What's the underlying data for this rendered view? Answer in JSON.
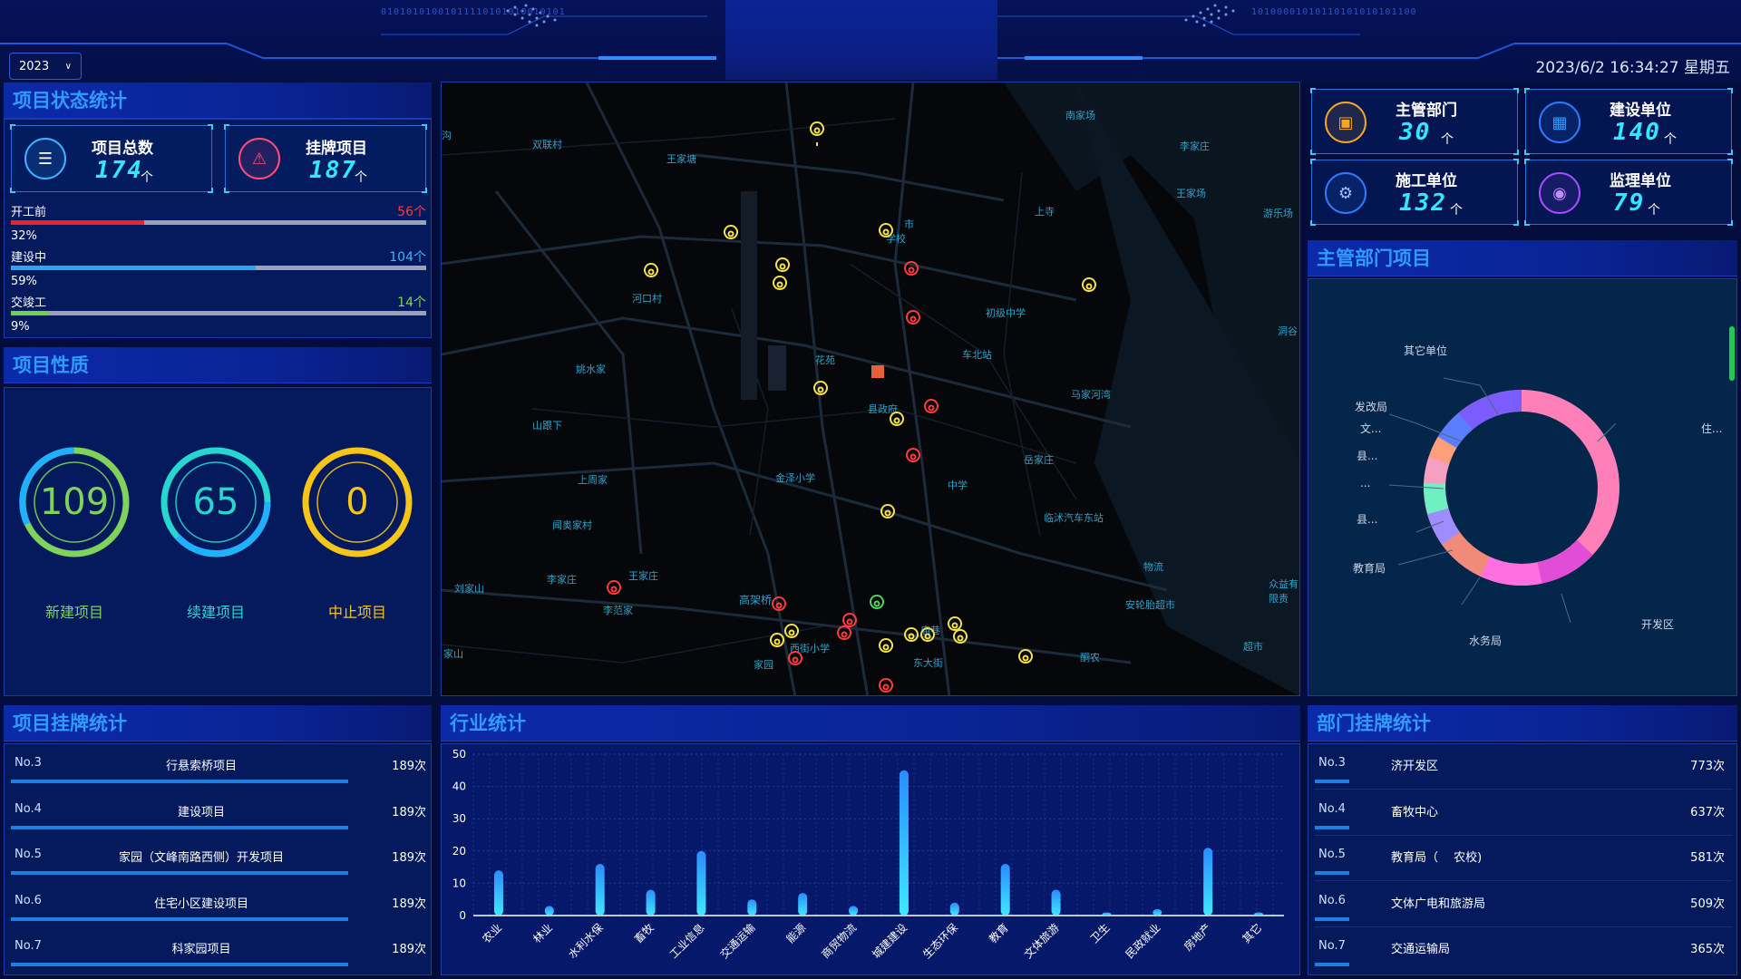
{
  "header": {
    "year": "2023",
    "datetime": "2023/6/2 16:34:27 星期五",
    "binary_left": "01010101001011110101010010101",
    "binary_right": "10100001010110101010101100"
  },
  "status_panel": {
    "title": "项目状态统计",
    "total_label": "项目总数",
    "total_value": "174",
    "total_unit": "个",
    "listed_label": "挂牌项目",
    "listed_value": "187",
    "listed_unit": "个",
    "rows": [
      {
        "label": "开工前",
        "count": "56个",
        "pct_label": "32%",
        "pct": 32,
        "color": "#e8242c",
        "count_color": "#ff3b3b"
      },
      {
        "label": "建设中",
        "count": "104个",
        "pct_label": "59%",
        "pct": 59,
        "color": "#2fa3f5",
        "count_color": "#3fb3ff"
      },
      {
        "label": "交竣工",
        "count": "14个",
        "pct_label": "9%",
        "pct": 9,
        "color": "#6fd24f",
        "count_color": "#7bd85a"
      }
    ]
  },
  "nature_panel": {
    "title": "项目性质",
    "rings": [
      {
        "value": "109",
        "label": "新建项目",
        "color": "#7fd35a",
        "text_color": "#7fd35a"
      },
      {
        "value": "65",
        "label": "续建项目",
        "color": "#27d6d0",
        "text_color": "#27d6d0"
      },
      {
        "value": "0",
        "label": "中止项目",
        "color": "#f5c518",
        "text_color": "#f5c518"
      }
    ]
  },
  "listing_panel": {
    "title": "项目挂牌统计",
    "rows": [
      {
        "no": "No.3",
        "name": "行悬索桥项目",
        "times": "189次"
      },
      {
        "no": "No.4",
        "name": "建设项目",
        "times": "189次"
      },
      {
        "no": "No.5",
        "name": "家园（文峰南路西侧）开发项目",
        "times": "189次"
      },
      {
        "no": "No.6",
        "name": "住宅小区建设项目",
        "times": "189次"
      },
      {
        "no": "No.7",
        "name": "科家园项目",
        "times": "189次"
      }
    ]
  },
  "industry_panel": {
    "title": "行业统计"
  },
  "chart_data": {
    "type": "bar",
    "title": "",
    "xlabel": "",
    "ylabel": "",
    "ylim": [
      0,
      50
    ],
    "yticks": [
      0,
      10,
      20,
      30,
      40,
      50
    ],
    "categories": [
      "农业",
      "林业",
      "水利水保",
      "畜牧",
      "工业信息",
      "交通运输",
      "能源",
      "商贸物流",
      "城建建设",
      "生态环保",
      "教育",
      "文体旅游",
      "卫生",
      "民政就业",
      "房地产",
      "其它"
    ],
    "values": [
      14,
      3,
      16,
      8,
      20,
      5,
      7,
      3,
      45,
      4,
      16,
      8,
      1,
      2,
      21,
      1
    ],
    "grid": true
  },
  "map": {
    "places": [
      "双联村",
      "王家塘",
      "河口村",
      "姚水家",
      "山跟下",
      "上周家",
      "闻奥家村",
      "李家庄",
      "刘家山",
      "王家庄",
      "李范家",
      "高架桥",
      "市",
      "学校",
      "初级中学",
      "车北站",
      "花苑",
      "县政府",
      "金泽小学",
      "中学",
      "临沭汽车东站",
      "马家河湾",
      "岳家庄",
      "南家场",
      "李家庄",
      "王家场",
      "上寺",
      "游乐场",
      "洞谷",
      "物流",
      "安轮胎超市",
      "众益有限责",
      "超市",
      "酮农",
      "庙巷",
      "东大街",
      "西街小学",
      "家园",
      "家山",
      "沟"
    ]
  },
  "top_stats": [
    {
      "label": "主管部门",
      "value": "30",
      "unit": "个",
      "icon": "building-icon",
      "color": "#f5a623"
    },
    {
      "label": "建设单位",
      "value": "140",
      "unit": "个",
      "icon": "office-icon",
      "color": "#2f7bff"
    },
    {
      "label": "施工单位",
      "value": "132",
      "unit": "个",
      "icon": "tool-icon",
      "color": "#2f7bff"
    },
    {
      "label": "监理单位",
      "value": "79",
      "unit": "个",
      "icon": "camera-icon",
      "color": "#a64dff"
    }
  ],
  "dept_project_panel": {
    "title": "主管部门项目",
    "labels": [
      "其它单位",
      "发改局",
      "文...",
      "县...",
      "...",
      "县...",
      "教育局",
      "水务局",
      "开发区",
      "住..."
    ]
  },
  "dept_listing_panel": {
    "title": "部门挂牌统计",
    "rows": [
      {
        "no": "No.3",
        "name": "济开发区",
        "value": "773次"
      },
      {
        "no": "No.4",
        "name": "畜牧中心",
        "value": "637次"
      },
      {
        "no": "No.5",
        "name": "教育局（　 农校)",
        "value": "581次"
      },
      {
        "no": "No.6",
        "name": "文体广电和旅游局",
        "value": "509次"
      },
      {
        "no": "No.7",
        "name": "交通运输局",
        "value": "365次"
      }
    ]
  }
}
